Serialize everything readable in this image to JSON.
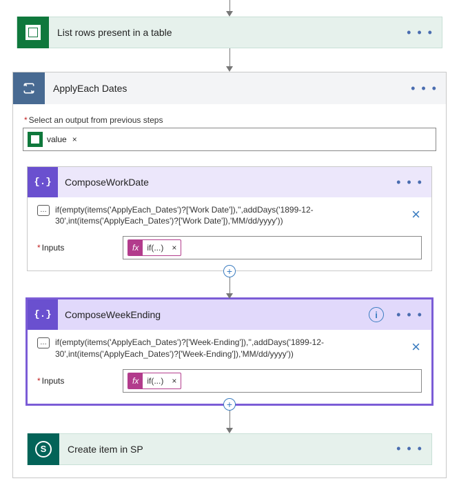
{
  "actions": {
    "listRows": {
      "label": "List rows present in a table"
    },
    "createSP": {
      "label": "Create item in SP"
    },
    "applyEach": {
      "label": "ApplyEach Dates"
    }
  },
  "selectOutputLabel": "Select an output from previous steps",
  "valueToken": "value",
  "tokenClose": "×",
  "moreDots": "• • •",
  "compose1": {
    "title": "ComposeWorkDate",
    "tooltip": "if(empty(items('ApplyEach_Dates')?['Work Date']),'',addDays('1899-12-30',int(items('ApplyEach_Dates')?['Work Date']),'MM/dd/yyyy'))",
    "inputsLabel": "Inputs",
    "fxLabel": "if(...)"
  },
  "compose2": {
    "title": "ComposeWeekEnding",
    "tooltip": "if(empty(items('ApplyEach_Dates')?['Week-Ending']),'',addDays('1899-12-30',int(items('ApplyEach_Dates')?['Week-Ending']),'MM/dd/yyyy'))",
    "inputsLabel": "Inputs",
    "fxLabel": "if(...)"
  },
  "glyphs": {
    "fx": "fx",
    "info": "i",
    "sp": "S",
    "plus": "+",
    "close": "×"
  }
}
